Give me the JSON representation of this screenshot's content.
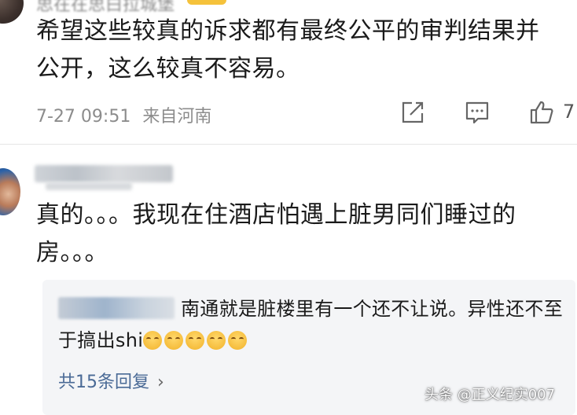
{
  "comment_1": {
    "username": "思在在思白拉城堡",
    "text": "希望这些较真的诉求都有最终公平的审判结果并\n公开，这么较真不容易。",
    "time": "7-27 09:51",
    "source": "来自河南",
    "like_count": "7",
    "icons": {
      "share": "share-icon",
      "comment": "comment-icon",
      "like": "thumbs-up-icon"
    }
  },
  "comment_2": {
    "username": "",
    "text": "真的。。。我现在住酒店怕遇上脏男同们睡过的\n房。。。",
    "reply": {
      "text": "南通就是脏楼里有一个还不让说。异性还不至于搞出shi",
      "emoji_count": 5,
      "emoji_name": "smirk-emoji"
    },
    "replies_link": "共15条回复",
    "replies_chevron": "›"
  },
  "watermark": "头条 @正义纪实007"
}
